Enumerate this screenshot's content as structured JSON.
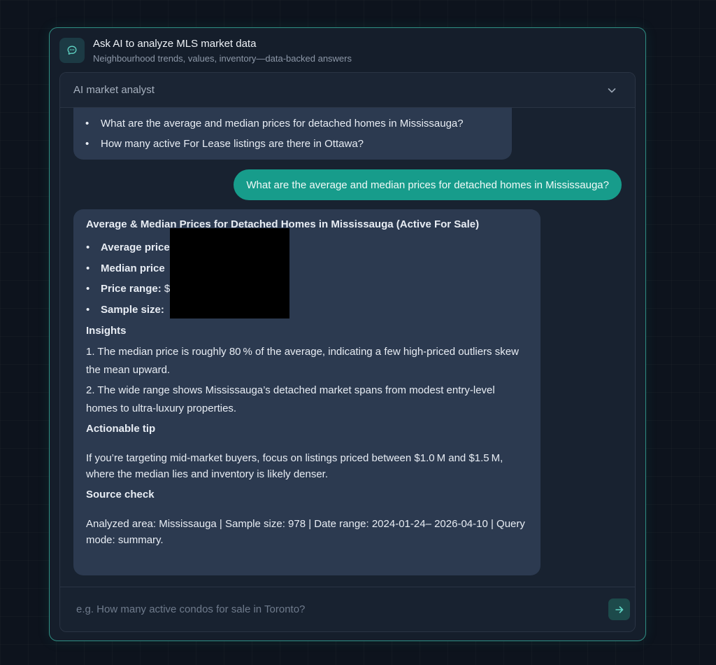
{
  "header": {
    "title": "Ask AI to analyze MLS market data",
    "subtitle": "Neighbourhood trends, values, inventory—data-backed answers",
    "icon": "chat-bubble-icon"
  },
  "chat": {
    "title": "AI market analyst",
    "toggle_icon": "chevron-down-icon"
  },
  "previous_message": {
    "items": [
      "What are the average and median prices for detached homes in Mississauga?",
      "How many active For Lease listings are there in Ottawa?"
    ]
  },
  "user_message": "What are the average and median prices for detached homes in Mississauga?",
  "answer": {
    "title": "Average & Median Prices for Detached Homes in Mississauga (Active For Sale)",
    "stats": [
      {
        "label": "Average price",
        "value": ""
      },
      {
        "label": "Median price",
        "value": ""
      },
      {
        "label": "Price range:",
        "value": "$"
      },
      {
        "label": "Sample size:",
        "value": ""
      }
    ],
    "insights_heading": "Insights",
    "insight_1": "1. The median price is roughly 80 % of the average, indicating a few high-priced outliers skew the mean upward.",
    "insight_2": "2. The wide range shows Mississauga’s detached market spans from modest entry-level homes to ultra-luxury properties.",
    "tip_heading": "Actionable tip",
    "tip_text": "If you’re targeting mid-market buyers, focus on listings priced between $1.0 M and $1.5 M, where the median lies and inventory is likely denser.",
    "source_heading": "Source check",
    "source_text": "Analyzed area: Mississauga | Sample size: 978 | Date range: 2024-01-24– 2026-04-10 | Query mode: summary."
  },
  "input": {
    "placeholder": "e.g. How many active condos for sale in Toronto?",
    "send_icon": "arrow-right-icon"
  },
  "colors": {
    "accent": "#179c8b",
    "panel_border": "#2f8f84",
    "bubble_ai": "#2c3a50"
  }
}
